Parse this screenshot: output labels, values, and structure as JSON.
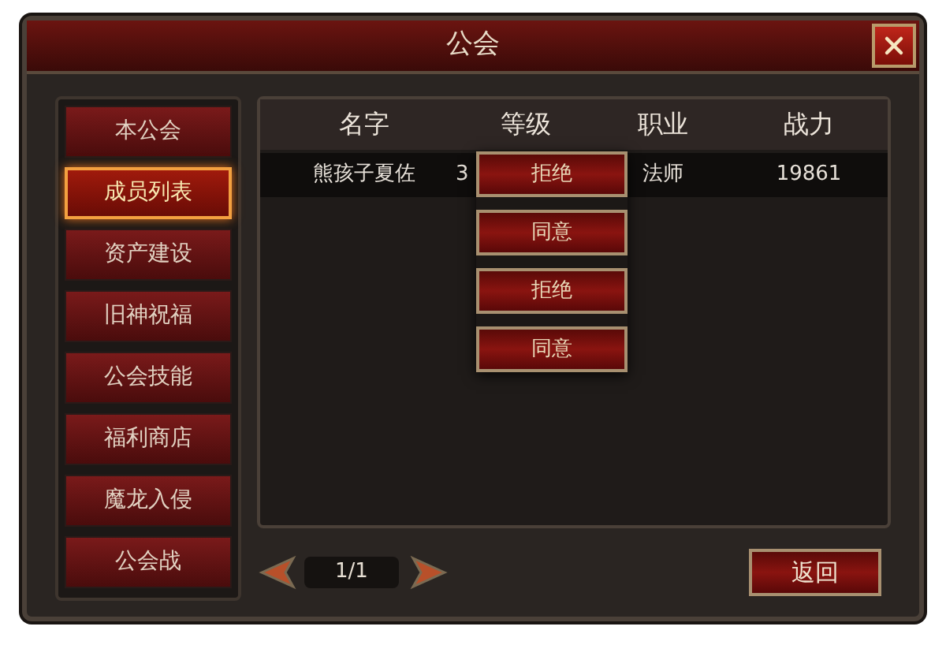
{
  "window": {
    "title": "公会"
  },
  "sidebar": {
    "items": [
      {
        "label": "本公会",
        "selected": false
      },
      {
        "label": "成员列表",
        "selected": true
      },
      {
        "label": "资产建设",
        "selected": false
      },
      {
        "label": "旧神祝福",
        "selected": false
      },
      {
        "label": "公会技能",
        "selected": false
      },
      {
        "label": "福利商店",
        "selected": false
      },
      {
        "label": "魔龙入侵",
        "selected": false
      },
      {
        "label": "公会战",
        "selected": false
      }
    ]
  },
  "table": {
    "columns": [
      "名字",
      "等级",
      "职业",
      "战力"
    ],
    "rows": [
      {
        "cells": [
          "熊孩子夏佐",
          "3",
          "法师",
          "19861"
        ]
      }
    ]
  },
  "popup_menu": {
    "actions": [
      "拒绝",
      "同意",
      "拒绝",
      "同意"
    ]
  },
  "pagination": {
    "page": "1/1"
  },
  "back_button": "返回"
}
